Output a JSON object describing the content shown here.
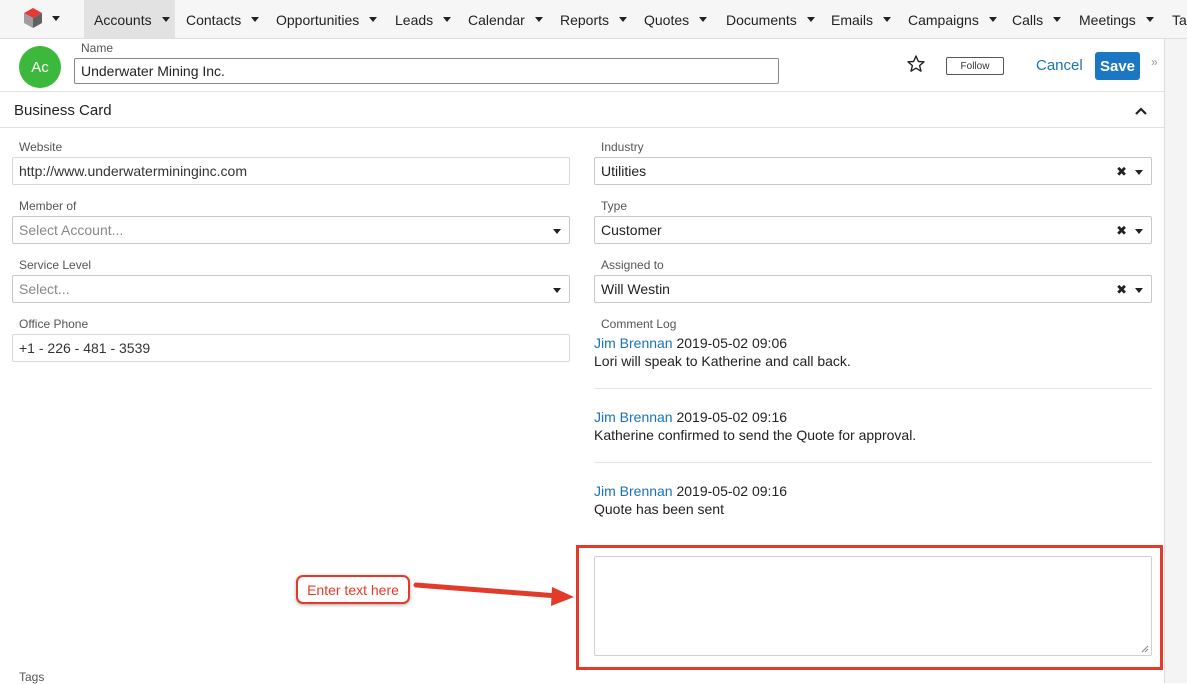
{
  "nav": {
    "items": [
      {
        "label": "Accounts",
        "active": true
      },
      {
        "label": "Contacts"
      },
      {
        "label": "Opportunities"
      },
      {
        "label": "Leads"
      },
      {
        "label": "Calendar"
      },
      {
        "label": "Reports"
      },
      {
        "label": "Quotes"
      },
      {
        "label": "Documents"
      },
      {
        "label": "Emails"
      },
      {
        "label": "Campaigns"
      },
      {
        "label": "Calls"
      },
      {
        "label": "Meetings"
      },
      {
        "label": "Tas"
      }
    ]
  },
  "header": {
    "avatar_initials": "Ac",
    "avatar_color": "#3cb93c",
    "name_label": "Name",
    "name_value": "Underwater Mining Inc.",
    "follow_label": "Follow",
    "cancel_label": "Cancel",
    "save_label": "Save"
  },
  "panel": {
    "title": "Business Card"
  },
  "fields": {
    "website": {
      "label": "Website",
      "value": "http://www.underwatermininginc.com"
    },
    "member_of": {
      "label": "Member of",
      "placeholder": "Select Account..."
    },
    "service_level": {
      "label": "Service Level",
      "placeholder": "Select..."
    },
    "office_phone": {
      "label": "Office Phone",
      "value": "+1 - 226 - 481 - 3539"
    },
    "industry": {
      "label": "Industry",
      "value": "Utilities"
    },
    "type": {
      "label": "Type",
      "value": "Customer"
    },
    "assigned_to": {
      "label": "Assigned to",
      "value": "Will Westin"
    },
    "tags": {
      "label": "Tags"
    }
  },
  "comment_log": {
    "label": "Comment Log",
    "entries": [
      {
        "author": "Jim Brennan",
        "timestamp": "2019-05-02 09:06",
        "text": "Lori will speak to Katherine and call back."
      },
      {
        "author": "Jim Brennan",
        "timestamp": "2019-05-02 09:16",
        "text": "Katherine confirmed to send the Quote for approval."
      },
      {
        "author": "Jim Brennan",
        "timestamp": "2019-05-02 09:16",
        "text": "Quote has been sent"
      }
    ]
  },
  "annotation": {
    "callout_text": "Enter text here",
    "color": "#e33b2a"
  },
  "colors": {
    "link": "#1a73b8",
    "save_button": "#1b76c4",
    "nav_active": "#e2e2e2"
  }
}
